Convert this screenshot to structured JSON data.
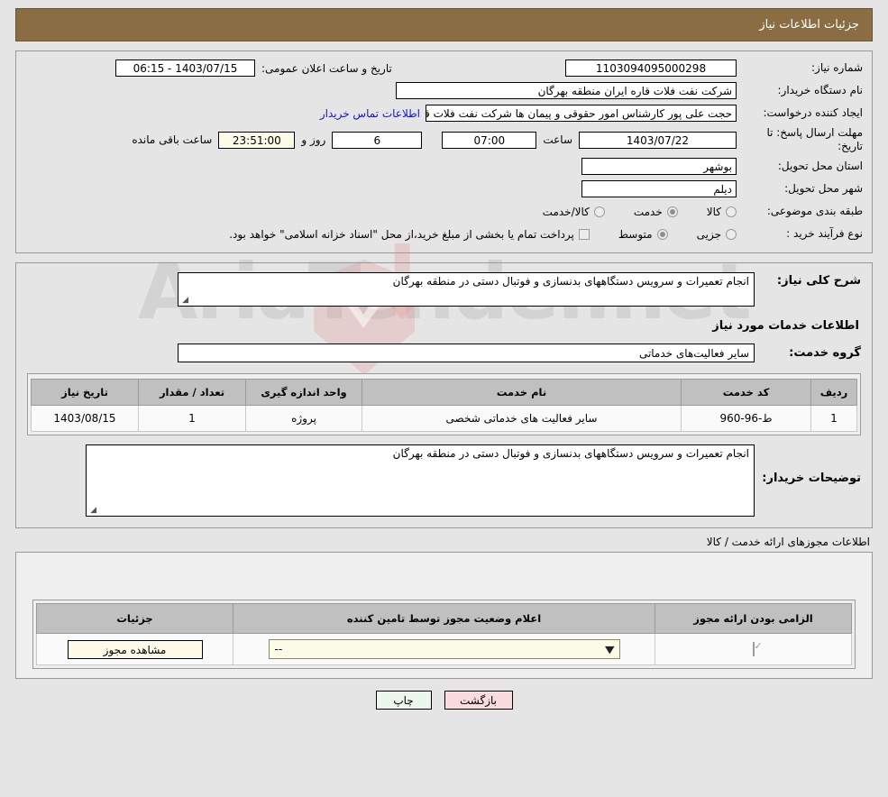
{
  "header": {
    "title": "جزئیات اطلاعات نیاز"
  },
  "top_form": {
    "need_no_label": "شماره نیاز:",
    "need_no_value": "1103094095000298",
    "public_announce_label": "تاریخ و ساعت اعلان عمومی:",
    "public_announce_value": "1403/07/15 - 06:15",
    "buyer_org_label": "نام دستگاه خریدار:",
    "buyer_org_value": "شرکت نفت فلات قاره ایران منطقه بهرگان",
    "creator_label": "ایجاد کننده درخواست:",
    "creator_value": "حجت علی پور کارشناس امور حقوقی و پیمان ها شرکت نفت فلات قاره ایران مند",
    "contact_link": "اطلاعات تماس خریدار",
    "deadline_label": "مهلت ارسال پاسخ: تا تاریخ:",
    "deadline_date": "1403/07/22",
    "hour_label": "ساعت",
    "deadline_time": "07:00",
    "days_value": "6",
    "days_label": "روز و",
    "remaining_time": "23:51:00",
    "remaining_label": "ساعت باقی مانده",
    "province_label": "استان محل تحویل:",
    "province_value": "بوشهر",
    "city_label": "شهر محل تحویل:",
    "city_value": "دیلم",
    "category_label": "طبقه بندی موضوعی:",
    "category_options": [
      {
        "label": "کالا",
        "selected": false
      },
      {
        "label": "خدمت",
        "selected": true
      },
      {
        "label": "کالا/خدمت",
        "selected": false
      }
    ],
    "process_label": "نوع فرآیند خرید :",
    "process_options": [
      {
        "label": "جزیی",
        "selected": false
      },
      {
        "label": "متوسط",
        "selected": true
      }
    ],
    "treasury_checkbox_checked": false,
    "treasury_note": "پرداخت تمام یا بخشی از مبلغ خرید،از محل \"اسناد خزانه اسلامی\" خواهد بود."
  },
  "details": {
    "general_desc_label": "شرح کلی نیاز:",
    "general_desc_value": "انجام تعمیرات و سرویس دستگاههای بدنسازی و فوتبال دستی در منطقه بهرگان",
    "services_section_title": "اطلاعات خدمات مورد نیاز",
    "service_group_label": "گروه خدمت:",
    "service_group_value": "سایر فعالیت‌های خدماتی",
    "table": {
      "headers": [
        "ردیف",
        "کد خدمت",
        "نام خدمت",
        "واحد اندازه گیری",
        "تعداد / مقدار",
        "تاریخ نیاز"
      ],
      "rows": [
        {
          "row_no": "1",
          "service_code": "ط-96-960",
          "service_name": "سایر فعالیت های خدماتی شخصی",
          "unit": "پروژه",
          "quantity": "1",
          "need_date": "1403/08/15"
        }
      ]
    },
    "buyer_notes_label": "توضیحات خریدار:",
    "buyer_notes_value": "انجام تعمیرات و سرویس دستگاههای بدنسازی و فوتبال دستی در منطقه بهرگان"
  },
  "permits": {
    "caption": "اطلاعات مجوزهای ارائه خدمت / کالا",
    "headers": [
      "الزامی بودن ارائه مجوز",
      "اعلام وضعیت مجوز توسط تامین کننده",
      "جزئیات"
    ],
    "rows": [
      {
        "required_checked": true,
        "status_value": "--",
        "details_button": "مشاهده مجوز"
      }
    ]
  },
  "footer": {
    "print_label": "چاپ",
    "back_label": "بازگشت"
  },
  "watermark": {
    "text": "AriaTender.net"
  },
  "colors": {
    "header_bg": "#8a6d43",
    "page_bg": "#e5e5e5",
    "link": "#1414c8",
    "print_btn": "#eaf7ea",
    "back_btn": "#fadcdc",
    "yellow_field": "#fbfbe7"
  }
}
